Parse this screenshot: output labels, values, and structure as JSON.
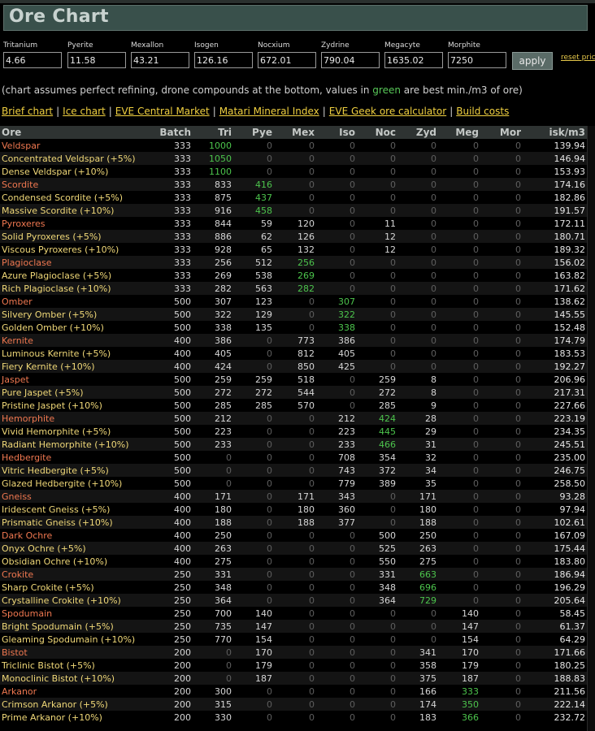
{
  "page": {
    "title": "Ore Chart"
  },
  "prices": [
    {
      "label": "Tritanium",
      "value": "4.66"
    },
    {
      "label": "Pyerite",
      "value": "11.58"
    },
    {
      "label": "Mexallon",
      "value": "43.21"
    },
    {
      "label": "Isogen",
      "value": "126.16"
    },
    {
      "label": "Nocxium",
      "value": "672.01"
    },
    {
      "label": "Zydrine",
      "value": "790.04"
    },
    {
      "label": "Megacyte",
      "value": "1635.02"
    },
    {
      "label": "Morphite",
      "value": "7250"
    }
  ],
  "apply_label": "apply",
  "reset_label": "reset pric",
  "note": {
    "before": "(chart assumes perfect refining, drone compounds at the bottom, values in ",
    "green": "green",
    "after": " are best min./m3 of ore)"
  },
  "links": [
    "Brief chart",
    "Ice chart",
    "EVE Central Market",
    "Matari Mineral Index",
    "EVE Geek ore calculator",
    "Build costs"
  ],
  "link_separator": "|",
  "table": {
    "headers": [
      "Ore",
      "Batch",
      "Tri",
      "Pye",
      "Mex",
      "Iso",
      "Noc",
      "Zyd",
      "Meg",
      "Mor",
      "isk/m3"
    ],
    "rows": [
      {
        "name": "Veldspar",
        "base": true,
        "v": [
          "333",
          "1000",
          "0",
          "0",
          "0",
          "0",
          "0",
          "0",
          "0",
          "139.94"
        ],
        "best": [
          1
        ]
      },
      {
        "name": "Concentrated Veldspar (+5%)",
        "base": false,
        "v": [
          "333",
          "1050",
          "0",
          "0",
          "0",
          "0",
          "0",
          "0",
          "0",
          "146.94"
        ],
        "best": [
          1
        ]
      },
      {
        "name": "Dense Veldspar (+10%)",
        "base": false,
        "v": [
          "333",
          "1100",
          "0",
          "0",
          "0",
          "0",
          "0",
          "0",
          "0",
          "153.93"
        ],
        "best": [
          1
        ]
      },
      {
        "name": "Scordite",
        "base": true,
        "v": [
          "333",
          "833",
          "416",
          "0",
          "0",
          "0",
          "0",
          "0",
          "0",
          "174.16"
        ],
        "best": [
          2
        ]
      },
      {
        "name": "Condensed Scordite (+5%)",
        "base": false,
        "v": [
          "333",
          "875",
          "437",
          "0",
          "0",
          "0",
          "0",
          "0",
          "0",
          "182.86"
        ],
        "best": [
          2
        ]
      },
      {
        "name": "Massive Scordite (+10%)",
        "base": false,
        "v": [
          "333",
          "916",
          "458",
          "0",
          "0",
          "0",
          "0",
          "0",
          "0",
          "191.57"
        ],
        "best": [
          2
        ]
      },
      {
        "name": "Pyroxeres",
        "base": true,
        "v": [
          "333",
          "844",
          "59",
          "120",
          "0",
          "11",
          "0",
          "0",
          "0",
          "172.11"
        ],
        "best": []
      },
      {
        "name": "Solid Pyroxeres (+5%)",
        "base": false,
        "v": [
          "333",
          "886",
          "62",
          "126",
          "0",
          "12",
          "0",
          "0",
          "0",
          "180.71"
        ],
        "best": []
      },
      {
        "name": "Viscous Pyroxeres (+10%)",
        "base": false,
        "v": [
          "333",
          "928",
          "65",
          "132",
          "0",
          "12",
          "0",
          "0",
          "0",
          "189.32"
        ],
        "best": []
      },
      {
        "name": "Plagioclase",
        "base": true,
        "v": [
          "333",
          "256",
          "512",
          "256",
          "0",
          "0",
          "0",
          "0",
          "0",
          "156.02"
        ],
        "best": [
          3
        ]
      },
      {
        "name": "Azure Plagioclase (+5%)",
        "base": false,
        "v": [
          "333",
          "269",
          "538",
          "269",
          "0",
          "0",
          "0",
          "0",
          "0",
          "163.82"
        ],
        "best": [
          3
        ]
      },
      {
        "name": "Rich Plagioclase (+10%)",
        "base": false,
        "v": [
          "333",
          "282",
          "563",
          "282",
          "0",
          "0",
          "0",
          "0",
          "0",
          "171.62"
        ],
        "best": [
          3
        ]
      },
      {
        "name": "Omber",
        "base": true,
        "v": [
          "500",
          "307",
          "123",
          "0",
          "307",
          "0",
          "0",
          "0",
          "0",
          "138.62"
        ],
        "best": [
          4
        ]
      },
      {
        "name": "Silvery Omber (+5%)",
        "base": false,
        "v": [
          "500",
          "322",
          "129",
          "0",
          "322",
          "0",
          "0",
          "0",
          "0",
          "145.55"
        ],
        "best": [
          4
        ]
      },
      {
        "name": "Golden Omber (+10%)",
        "base": false,
        "v": [
          "500",
          "338",
          "135",
          "0",
          "338",
          "0",
          "0",
          "0",
          "0",
          "152.48"
        ],
        "best": [
          4
        ]
      },
      {
        "name": "Kernite",
        "base": true,
        "v": [
          "400",
          "386",
          "0",
          "773",
          "386",
          "0",
          "0",
          "0",
          "0",
          "174.79"
        ],
        "best": []
      },
      {
        "name": "Luminous Kernite (+5%)",
        "base": false,
        "v": [
          "400",
          "405",
          "0",
          "812",
          "405",
          "0",
          "0",
          "0",
          "0",
          "183.53"
        ],
        "best": []
      },
      {
        "name": "Fiery Kernite (+10%)",
        "base": false,
        "v": [
          "400",
          "424",
          "0",
          "850",
          "425",
          "0",
          "0",
          "0",
          "0",
          "192.27"
        ],
        "best": []
      },
      {
        "name": "Jaspet",
        "base": true,
        "v": [
          "500",
          "259",
          "259",
          "518",
          "0",
          "259",
          "8",
          "0",
          "0",
          "206.96"
        ],
        "best": []
      },
      {
        "name": "Pure Jaspet (+5%)",
        "base": false,
        "v": [
          "500",
          "272",
          "272",
          "544",
          "0",
          "272",
          "8",
          "0",
          "0",
          "217.31"
        ],
        "best": []
      },
      {
        "name": "Pristine Jaspet (+10%)",
        "base": false,
        "v": [
          "500",
          "285",
          "285",
          "570",
          "0",
          "285",
          "9",
          "0",
          "0",
          "227.66"
        ],
        "best": []
      },
      {
        "name": "Hemorphite",
        "base": true,
        "v": [
          "500",
          "212",
          "0",
          "0",
          "212",
          "424",
          "28",
          "0",
          "0",
          "223.19"
        ],
        "best": [
          5
        ]
      },
      {
        "name": "Vivid Hemorphite (+5%)",
        "base": false,
        "v": [
          "500",
          "223",
          "0",
          "0",
          "223",
          "445",
          "29",
          "0",
          "0",
          "234.35"
        ],
        "best": [
          5
        ]
      },
      {
        "name": "Radiant Hemorphite (+10%)",
        "base": false,
        "v": [
          "500",
          "233",
          "0",
          "0",
          "233",
          "466",
          "31",
          "0",
          "0",
          "245.51"
        ],
        "best": [
          5
        ]
      },
      {
        "name": "Hedbergite",
        "base": true,
        "v": [
          "500",
          "0",
          "0",
          "0",
          "708",
          "354",
          "32",
          "0",
          "0",
          "235.00"
        ],
        "best": []
      },
      {
        "name": "Vitric Hedbergite (+5%)",
        "base": false,
        "v": [
          "500",
          "0",
          "0",
          "0",
          "743",
          "372",
          "34",
          "0",
          "0",
          "246.75"
        ],
        "best": []
      },
      {
        "name": "Glazed Hedbergite (+10%)",
        "base": false,
        "v": [
          "500",
          "0",
          "0",
          "0",
          "779",
          "389",
          "35",
          "0",
          "0",
          "258.50"
        ],
        "best": []
      },
      {
        "name": "Gneiss",
        "base": true,
        "v": [
          "400",
          "171",
          "0",
          "171",
          "343",
          "0",
          "171",
          "0",
          "0",
          "93.28"
        ],
        "best": []
      },
      {
        "name": "Iridescent Gneiss (+5%)",
        "base": false,
        "v": [
          "400",
          "180",
          "0",
          "180",
          "360",
          "0",
          "180",
          "0",
          "0",
          "97.94"
        ],
        "best": []
      },
      {
        "name": "Prismatic Gneiss (+10%)",
        "base": false,
        "v": [
          "400",
          "188",
          "0",
          "188",
          "377",
          "0",
          "188",
          "0",
          "0",
          "102.61"
        ],
        "best": []
      },
      {
        "name": "Dark Ochre",
        "base": true,
        "v": [
          "400",
          "250",
          "0",
          "0",
          "0",
          "500",
          "250",
          "0",
          "0",
          "167.09"
        ],
        "best": []
      },
      {
        "name": "Onyx Ochre (+5%)",
        "base": false,
        "v": [
          "400",
          "263",
          "0",
          "0",
          "0",
          "525",
          "263",
          "0",
          "0",
          "175.44"
        ],
        "best": []
      },
      {
        "name": "Obsidian Ochre (+10%)",
        "base": false,
        "v": [
          "400",
          "275",
          "0",
          "0",
          "0",
          "550",
          "275",
          "0",
          "0",
          "183.80"
        ],
        "best": []
      },
      {
        "name": "Crokite",
        "base": true,
        "v": [
          "250",
          "331",
          "0",
          "0",
          "0",
          "331",
          "663",
          "0",
          "0",
          "186.94"
        ],
        "best": [
          6
        ]
      },
      {
        "name": "Sharp Crokite (+5%)",
        "base": false,
        "v": [
          "250",
          "348",
          "0",
          "0",
          "0",
          "348",
          "696",
          "0",
          "0",
          "196.29"
        ],
        "best": [
          6
        ]
      },
      {
        "name": "Crystalline Crokite (+10%)",
        "base": false,
        "v": [
          "250",
          "364",
          "0",
          "0",
          "0",
          "364",
          "729",
          "0",
          "0",
          "205.64"
        ],
        "best": [
          6
        ]
      },
      {
        "name": "Spodumain",
        "base": true,
        "v": [
          "250",
          "700",
          "140",
          "0",
          "0",
          "0",
          "0",
          "140",
          "0",
          "58.45"
        ],
        "best": []
      },
      {
        "name": "Bright Spodumain (+5%)",
        "base": false,
        "v": [
          "250",
          "735",
          "147",
          "0",
          "0",
          "0",
          "0",
          "147",
          "0",
          "61.37"
        ],
        "best": []
      },
      {
        "name": "Gleaming Spodumain (+10%)",
        "base": false,
        "v": [
          "250",
          "770",
          "154",
          "0",
          "0",
          "0",
          "0",
          "154",
          "0",
          "64.29"
        ],
        "best": []
      },
      {
        "name": "Bistot",
        "base": true,
        "v": [
          "200",
          "0",
          "170",
          "0",
          "0",
          "0",
          "341",
          "170",
          "0",
          "171.66"
        ],
        "best": []
      },
      {
        "name": "Triclinic Bistot (+5%)",
        "base": false,
        "v": [
          "200",
          "0",
          "179",
          "0",
          "0",
          "0",
          "358",
          "179",
          "0",
          "180.25"
        ],
        "best": []
      },
      {
        "name": "Monoclinic Bistot (+10%)",
        "base": false,
        "v": [
          "200",
          "0",
          "187",
          "0",
          "0",
          "0",
          "375",
          "187",
          "0",
          "188.83"
        ],
        "best": []
      },
      {
        "name": "Arkanor",
        "base": true,
        "v": [
          "200",
          "300",
          "0",
          "0",
          "0",
          "0",
          "166",
          "333",
          "0",
          "211.56"
        ],
        "best": [
          7
        ]
      },
      {
        "name": "Crimson Arkanor (+5%)",
        "base": false,
        "v": [
          "200",
          "315",
          "0",
          "0",
          "0",
          "0",
          "174",
          "350",
          "0",
          "222.14"
        ],
        "best": [
          7
        ]
      },
      {
        "name": "Prime Arkanor (+10%)",
        "base": false,
        "v": [
          "200",
          "330",
          "0",
          "0",
          "0",
          "0",
          "183",
          "366",
          "0",
          "232.72"
        ],
        "best": [
          7
        ]
      }
    ]
  }
}
